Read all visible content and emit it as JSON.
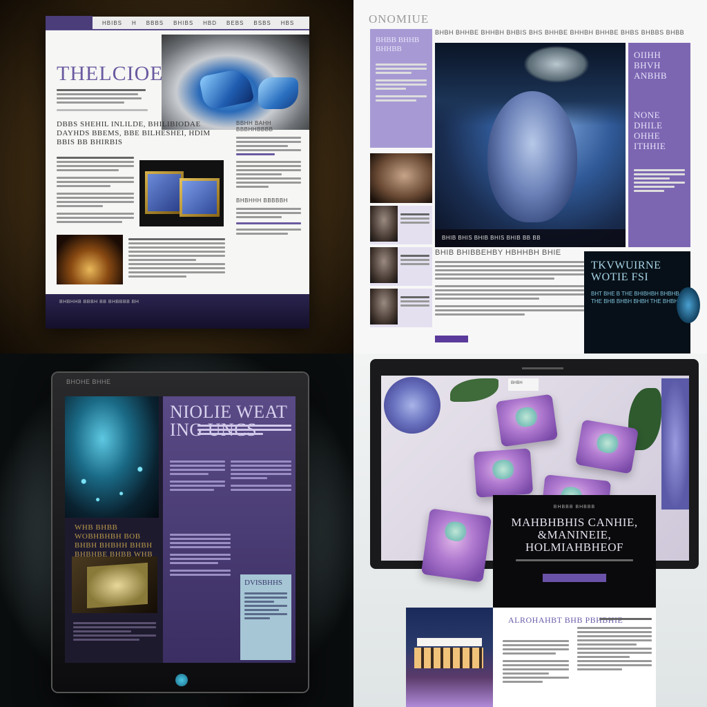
{
  "q1": {
    "title": "THELCIOE",
    "nav": [
      "HBIBS",
      "H",
      "BBBS",
      "BHIBS",
      "HBD",
      "BEBS",
      "BSBS",
      "HBS"
    ],
    "headline": "DBBS SHEHIL INLILDE, BHILIBIODAE DAYHDS BBEMS, BBE BILHESHEI, HDIM BBIS BB BHIRBIS",
    "side_titles": [
      "BBHH BAHH BBBHHBBBB",
      "BHBHHH BBBBBH"
    ],
    "footer": "BHBHHB BBBH BB BHBBBB BH"
  },
  "q2": {
    "logo": "ONOMIUE",
    "topbar": "BHBH BHHBE BHHBH BHBIS BHS BHHBE BHHBH BHHBE BHBS BHBBS BHBB",
    "sidebox": "BHBB BHHB BHHBB",
    "hero_caption": "BHIB BHIS BHIB BHIS BHIB BB BB",
    "right_col_a": "OIIHH BHVH ANBHB",
    "right_col_b": "NONE DHILE OHHE ITHHIE",
    "article_head": "BHIB BHIBBEHBY HBHHBH BHIE",
    "dark_head": "TKVWUIRNE WOTIE FSI",
    "dark_body": "BHT BHE B THE BHIBHBH BHBHB THE BHB BHBH BHBH THE BHBH"
  },
  "q3": {
    "topbar": "BHOHE          BHHE",
    "headline": "NIOLIE WEAT ING UNCS",
    "gold_text": "WHB BHBB WOBHBHBH BOB BHBH BHBHH BHBH BHBHBE BHBB WHB BBI",
    "lightbox_head": "DVISBHHS"
  },
  "q4": {
    "tag": "BHBH",
    "kicker": "BHBBB BHBBB",
    "headline": "MAHBHBHIS CANHIE, &MANINEIE, HOLMIAHBHEOF",
    "lower_head": "ALROHAHBT BHB PBHBHIE"
  },
  "colors": {
    "q1_accent": "#6a5aa0",
    "q2_purple": "#7c66b2",
    "q3_purple": "#5a4a86",
    "q4_button": "#6a52a8"
  }
}
